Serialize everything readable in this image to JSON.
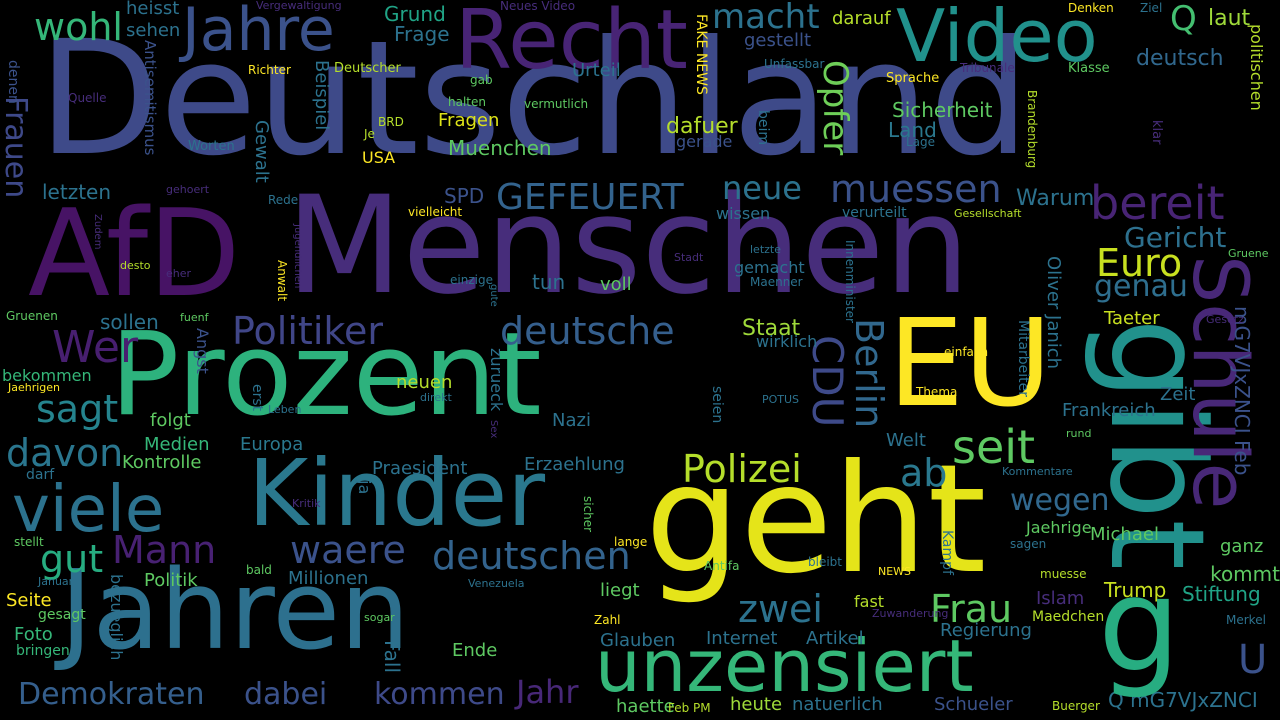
{
  "words": [
    {
      "text": "Deutschland",
      "color": "#3e4a89"
    },
    {
      "text": "Menschen",
      "color": "#472d7b"
    },
    {
      "text": "AfD",
      "color": "#471365"
    },
    {
      "text": "Prozent",
      "color": "#2db27d"
    },
    {
      "text": "Jahren",
      "color": "#2d708e"
    },
    {
      "text": "Kinder",
      "color": "#2a788e"
    },
    {
      "text": "geht",
      "color": "#e5e419"
    },
    {
      "text": "gibt",
      "color": "#21918c"
    },
    {
      "text": "EU",
      "color": "#fde725"
    },
    {
      "text": "Schule",
      "color": "#482878"
    },
    {
      "text": "Recht",
      "color": "#482475"
    },
    {
      "text": "Jahre",
      "color": "#3b528b"
    },
    {
      "text": "Video",
      "color": "#21918c"
    },
    {
      "text": "viele",
      "color": "#2c728e"
    },
    {
      "text": "unzensiert",
      "color": "#35b779"
    },
    {
      "text": "Politiker",
      "color": "#404688"
    },
    {
      "text": "deutsche",
      "color": "#355f8d"
    },
    {
      "text": "deutschen",
      "color": "#33638d"
    },
    {
      "text": "waere",
      "color": "#3b528b"
    },
    {
      "text": "Mann",
      "color": "#482173"
    },
    {
      "text": "Wer",
      "color": "#481f70"
    },
    {
      "text": "sagt",
      "color": "#25848e"
    },
    {
      "text": "davon",
      "color": "#2a768e"
    },
    {
      "text": "Polizei",
      "color": "#b5de2b"
    },
    {
      "text": "seit",
      "color": "#5ec962"
    },
    {
      "text": "ab",
      "color": "#2a788e"
    },
    {
      "text": "CDU",
      "color": "#3e4a89"
    },
    {
      "text": "Berlin",
      "color": "#31688e"
    },
    {
      "text": "Opfer",
      "color": "#6ece58"
    },
    {
      "text": "muessen",
      "color": "#3b528b"
    },
    {
      "text": "bereit",
      "color": "#482475"
    },
    {
      "text": "Euro",
      "color": "#c8e020"
    },
    {
      "text": "genau",
      "color": "#2e6e8e"
    },
    {
      "text": "Gericht",
      "color": "#2d708e"
    },
    {
      "text": "neue",
      "color": "#2c728e"
    },
    {
      "text": "GEFEUERT",
      "color": "#33638d"
    },
    {
      "text": "macht",
      "color": "#2c728e"
    },
    {
      "text": "wohl",
      "color": "#35b779"
    },
    {
      "text": "Q",
      "color": "#44bf70"
    },
    {
      "text": "laut",
      "color": "#9fda3a"
    },
    {
      "text": "deutsch",
      "color": "#31688e"
    },
    {
      "text": "Frauen",
      "color": "#3e4989"
    },
    {
      "text": "zwei",
      "color": "#2c728e"
    },
    {
      "text": "Frau",
      "color": "#5ec962"
    },
    {
      "text": "wegen",
      "color": "#31688e"
    },
    {
      "text": "Demokraten",
      "color": "#355f8d"
    },
    {
      "text": "dabei",
      "color": "#3b528b"
    },
    {
      "text": "kommen",
      "color": "#3e4a89"
    },
    {
      "text": "Jahr",
      "color": "#482878"
    },
    {
      "text": "gut",
      "color": "#27ad81"
    },
    {
      "text": "Staat",
      "color": "#9fda3a"
    },
    {
      "text": "Warum",
      "color": "#2c728e"
    },
    {
      "text": "Sicherheit",
      "color": "#5ec962"
    },
    {
      "text": "dafuer",
      "color": "#b5de2b"
    },
    {
      "text": "Fragen",
      "color": "#dde318"
    },
    {
      "text": "Muenchen",
      "color": "#5ec962"
    },
    {
      "text": "Land",
      "color": "#2a788e"
    },
    {
      "text": "Grund",
      "color": "#20a486"
    },
    {
      "text": "Frage",
      "color": "#2c728e"
    },
    {
      "text": "Urteil",
      "color": "#2c728e"
    },
    {
      "text": "gestellt",
      "color": "#3b528b"
    },
    {
      "text": "darauf",
      "color": "#b5de2b"
    },
    {
      "text": "heisst",
      "color": "#2c728e"
    },
    {
      "text": "sehen",
      "color": "#2c728e"
    },
    {
      "text": "letzten",
      "color": "#2c728e"
    },
    {
      "text": "sollen",
      "color": "#2c728e"
    },
    {
      "text": "SPD",
      "color": "#3b528b"
    },
    {
      "text": "Beispiel",
      "color": "#2c728e"
    },
    {
      "text": "Gewalt",
      "color": "#2c728e"
    },
    {
      "text": "Antisemitismus",
      "color": "#3b528b"
    },
    {
      "text": "Medien",
      "color": "#35b779"
    },
    {
      "text": "Europa",
      "color": "#2a788e"
    },
    {
      "text": "Kontrolle",
      "color": "#5ec962"
    },
    {
      "text": "folgt",
      "color": "#5ec962"
    },
    {
      "text": "Praesident",
      "color": "#2c728e"
    },
    {
      "text": "Erzaehlung",
      "color": "#2c728e"
    },
    {
      "text": "Nazi",
      "color": "#2c728e"
    },
    {
      "text": "neuen",
      "color": "#b5de2b"
    },
    {
      "text": "zurueck",
      "color": "#2c728e"
    },
    {
      "text": "Millionen",
      "color": "#2c728e"
    },
    {
      "text": "Politik",
      "color": "#5ec962"
    },
    {
      "text": "Seite",
      "color": "#fde725"
    },
    {
      "text": "Foto",
      "color": "#35b779"
    },
    {
      "text": "gesagt",
      "color": "#5ec962"
    },
    {
      "text": "bringen",
      "color": "#35b779"
    },
    {
      "text": "Trump",
      "color": "#c8e020"
    },
    {
      "text": "kommt",
      "color": "#5ec962"
    },
    {
      "text": "Stiftung",
      "color": "#20a486"
    },
    {
      "text": "Islam",
      "color": "#472d7b"
    },
    {
      "text": "Maedchen",
      "color": "#b5de2b"
    },
    {
      "text": "Regierung",
      "color": "#2c728e"
    },
    {
      "text": "Artikel",
      "color": "#2c728e"
    },
    {
      "text": "Internet",
      "color": "#2c728e"
    },
    {
      "text": "Glauben",
      "color": "#2c728e"
    },
    {
      "text": "Ende",
      "color": "#5ec962"
    },
    {
      "text": "Fall",
      "color": "#2c728e"
    },
    {
      "text": "heute",
      "color": "#9fda3a"
    },
    {
      "text": "natuerlich",
      "color": "#2c728e"
    },
    {
      "text": "haette",
      "color": "#5ec962"
    },
    {
      "text": "Schueler",
      "color": "#3b528b"
    },
    {
      "text": "Q mG7VJxZNCI",
      "color": "#2c728e"
    },
    {
      "text": "mG7VJxZNCI Feb",
      "color": "#3b528b"
    },
    {
      "text": "politischen",
      "color": "#b5de2b"
    },
    {
      "text": "Frankreich",
      "color": "#2c728e"
    },
    {
      "text": "Zeit",
      "color": "#2c728e"
    },
    {
      "text": "Oliver Janich",
      "color": "#2c728e"
    },
    {
      "text": "Mitarbeiter",
      "color": "#2c728e"
    },
    {
      "text": "Taeter",
      "color": "#c8e020"
    },
    {
      "text": "Welt",
      "color": "#2c728e"
    },
    {
      "text": "Michael",
      "color": "#5ec962"
    },
    {
      "text": "Jaehrige",
      "color": "#5ec962"
    },
    {
      "text": "ganz",
      "color": "#5ec962"
    },
    {
      "text": "Kampf",
      "color": "#2c728e"
    },
    {
      "text": "fast",
      "color": "#b5de2b"
    },
    {
      "text": "liegt",
      "color": "#5ec962"
    },
    {
      "text": "wirklich",
      "color": "#2c728e"
    },
    {
      "text": "gemacht",
      "color": "#2c728e"
    },
    {
      "text": "tun",
      "color": "#2c728e"
    },
    {
      "text": "voll",
      "color": "#5ec962"
    },
    {
      "text": "wissen",
      "color": "#2c728e"
    },
    {
      "text": "verurteilt",
      "color": "#2c728e"
    },
    {
      "text": "beim",
      "color": "#2c728e"
    },
    {
      "text": "gerade",
      "color": "#3b528b"
    },
    {
      "text": "Angst",
      "color": "#3b528b"
    },
    {
      "text": "erst",
      "color": "#2c728e"
    },
    {
      "text": "bekommen",
      "color": "#35b779"
    },
    {
      "text": "darf",
      "color": "#2c728e"
    },
    {
      "text": "USA",
      "color": "#fde725"
    },
    {
      "text": "BRD",
      "color": "#b5de2b"
    },
    {
      "text": "Worten",
      "color": "#2c728e"
    },
    {
      "text": "Deutscher",
      "color": "#b5de2b"
    },
    {
      "text": "Richter",
      "color": "#fde725"
    },
    {
      "text": "gab",
      "color": "#5ec962"
    },
    {
      "text": "halten",
      "color": "#5ec962"
    },
    {
      "text": "vermutlich",
      "color": "#5ec962"
    },
    {
      "text": "FAKE NEWS",
      "color": "#fde725"
    },
    {
      "text": "Unfassbar",
      "color": "#2c728e"
    },
    {
      "text": "Sprache",
      "color": "#fde725"
    },
    {
      "text": "Tribunale",
      "color": "#472d7b"
    },
    {
      "text": "Klasse",
      "color": "#5ec962"
    },
    {
      "text": "Brandenburg",
      "color": "#b5de2b"
    },
    {
      "text": "Lage",
      "color": "#2c728e"
    },
    {
      "text": "klar",
      "color": "#472d7b"
    },
    {
      "text": "Gesellschaft",
      "color": "#b5de2b"
    },
    {
      "text": "vielleicht",
      "color": "#fde725"
    },
    {
      "text": "Rede",
      "color": "#2c728e"
    },
    {
      "text": "gehoert",
      "color": "#472d7b"
    },
    {
      "text": "Quelle",
      "color": "#472d7b"
    },
    {
      "text": "Neues Video",
      "color": "#472d7b"
    },
    {
      "text": "Vergewaltigung",
      "color": "#472d7b"
    },
    {
      "text": "Denken",
      "color": "#fde725"
    },
    {
      "text": "Ziel",
      "color": "#2c728e"
    },
    {
      "text": "Je",
      "color": "#b5de2b"
    },
    {
      "text": "denen",
      "color": "#3b528b"
    },
    {
      "text": "Zudem",
      "color": "#472d7b"
    },
    {
      "text": "desto",
      "color": "#b5de2b"
    },
    {
      "text": "eher",
      "color": "#472d7b"
    },
    {
      "text": "Jugendlichen",
      "color": "#472d7b"
    },
    {
      "text": "Anwalt",
      "color": "#fde725"
    },
    {
      "text": "einzige",
      "color": "#2c728e"
    },
    {
      "text": "gute",
      "color": "#2c728e"
    },
    {
      "text": "fuenf",
      "color": "#5ec962"
    },
    {
      "text": "Gruenen",
      "color": "#5ec962"
    },
    {
      "text": "Stadt",
      "color": "#472d7b"
    },
    {
      "text": "letzte",
      "color": "#2c728e"
    },
    {
      "text": "Maenner",
      "color": "#2c728e"
    },
    {
      "text": "Innenminister",
      "color": "#2c728e"
    },
    {
      "text": "Gruene",
      "color": "#5ec962"
    },
    {
      "text": "Gesetz",
      "color": "#472d7b"
    },
    {
      "text": "einfach",
      "color": "#fde725"
    },
    {
      "text": "Thema",
      "color": "#fde725"
    },
    {
      "text": "POTUS",
      "color": "#2c728e"
    },
    {
      "text": "seien",
      "color": "#2c728e"
    },
    {
      "text": "direkt",
      "color": "#2c728e"
    },
    {
      "text": "Leben",
      "color": "#2c728e"
    },
    {
      "text": "Jaehrigen",
      "color": "#fde725"
    },
    {
      "text": "Sex",
      "color": "#472d7b"
    },
    {
      "text": "rund",
      "color": "#5ec962"
    },
    {
      "text": "Kommentare",
      "color": "#2c728e"
    },
    {
      "text": "Kritik",
      "color": "#472d7b"
    },
    {
      "text": "ja",
      "color": "#2c728e"
    },
    {
      "text": "sicher",
      "color": "#5ec962"
    },
    {
      "text": "lange",
      "color": "#fde725"
    },
    {
      "text": "stellt",
      "color": "#5ec962"
    },
    {
      "text": "Januar",
      "color": "#2c728e"
    },
    {
      "text": "bezueglich",
      "color": "#2c728e"
    },
    {
      "text": "bald",
      "color": "#5ec962"
    },
    {
      "text": "Antifa",
      "color": "#5ec962"
    },
    {
      "text": "bleibt",
      "color": "#2c728e"
    },
    {
      "text": "NEWS",
      "color": "#fde725"
    },
    {
      "text": "sagen",
      "color": "#2c728e"
    },
    {
      "text": "muesse",
      "color": "#b5de2b"
    },
    {
      "text": "Venezuela",
      "color": "#2c728e"
    },
    {
      "text": "Zuwanderung",
      "color": "#472d7b"
    },
    {
      "text": "sogar",
      "color": "#5ec962"
    },
    {
      "text": "Zahl",
      "color": "#fde725"
    },
    {
      "text": "Merkel",
      "color": "#2c728e"
    },
    {
      "text": "Feb PM",
      "color": "#b5de2b"
    },
    {
      "text": "Buerger",
      "color": "#b5de2b"
    },
    {
      "text": "U",
      "color": "#3b528b"
    },
    {
      "text": "g",
      "color": "#27ad81"
    }
  ]
}
